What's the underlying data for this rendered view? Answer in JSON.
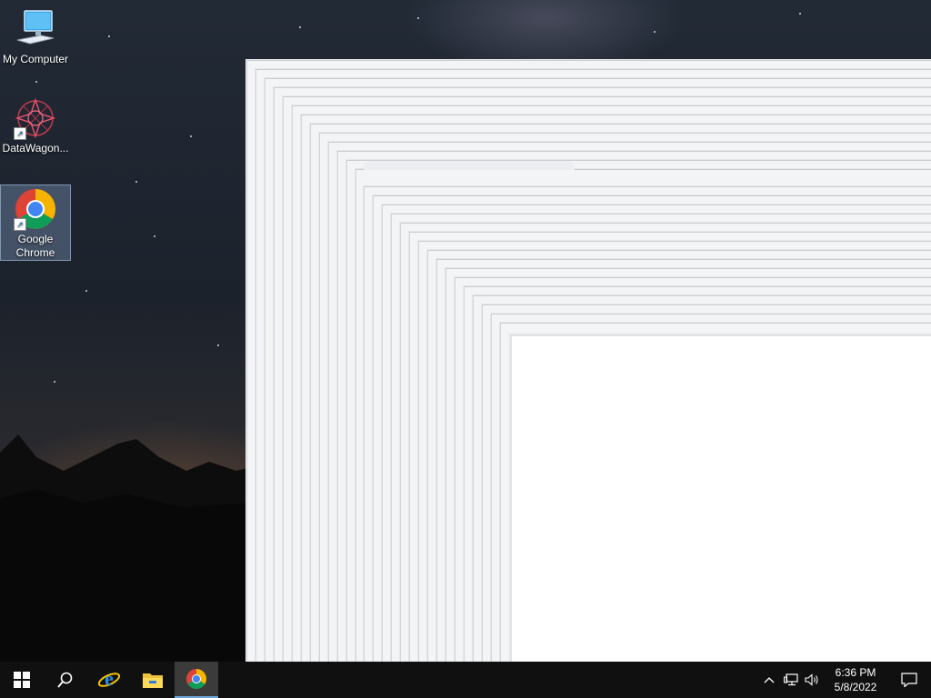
{
  "desktop": {
    "icons": [
      {
        "label": "My Computer",
        "icon": "computer-icon"
      },
      {
        "label": "DataWagon...",
        "icon": "datawagon-icon"
      },
      {
        "label": "Google Chrome",
        "icon": "chrome-icon",
        "selected": true
      }
    ]
  },
  "taskbar": {
    "buttons": [
      {
        "icon": "windows-start-icon"
      },
      {
        "icon": "search-icon"
      },
      {
        "icon": "internet-explorer-icon"
      },
      {
        "icon": "file-explorer-icon"
      },
      {
        "icon": "chrome-icon",
        "active": true
      }
    ],
    "tray": {
      "icons": [
        "chevron-up-icon",
        "network-icon",
        "speaker-icon"
      ],
      "time": "6:36 PM",
      "date": "5/8/2022",
      "notification_icon": "notification-icon"
    }
  },
  "colors": {
    "taskbar": "#101010",
    "active_taskbar_item": "#3b3b3b",
    "window_ghost": "#f3f4f5"
  }
}
